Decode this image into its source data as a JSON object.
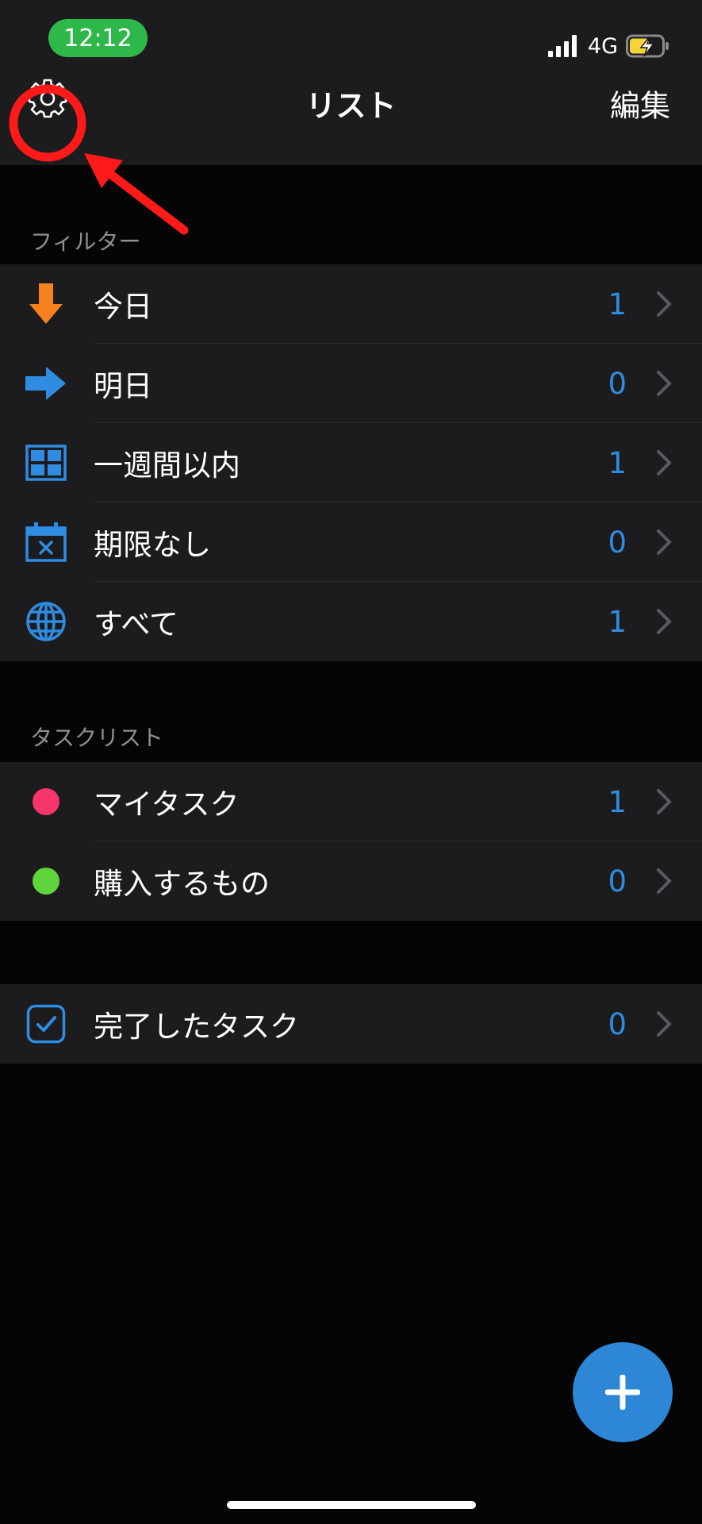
{
  "status_bar": {
    "time": "12:12",
    "network": "4G",
    "pill_color": "#2fb84a"
  },
  "nav": {
    "title": "リスト",
    "edit_label": "編集",
    "settings_icon": "gear-icon"
  },
  "filters": {
    "header": "フィルター",
    "items": [
      {
        "label": "今日",
        "count": "1",
        "icon": "arrow-down-icon",
        "color": "#f5821f"
      },
      {
        "label": "明日",
        "count": "0",
        "icon": "arrow-right-icon",
        "color": "#2f8ce0"
      },
      {
        "label": "一週間以内",
        "count": "1",
        "icon": "calendar-grid-icon",
        "color": "#2f8ce0"
      },
      {
        "label": "期限なし",
        "count": "0",
        "icon": "calendar-x-icon",
        "color": "#2f8ce0"
      },
      {
        "label": "すべて",
        "count": "1",
        "icon": "globe-icon",
        "color": "#2f8ce0"
      }
    ]
  },
  "task_lists": {
    "header": "タスクリスト",
    "items": [
      {
        "label": "マイタスク",
        "count": "1",
        "color": "#f5356b"
      },
      {
        "label": "購入するもの",
        "count": "0",
        "color": "#5fd33c"
      }
    ]
  },
  "completed": {
    "label": "完了したタスク",
    "count": "0",
    "icon": "checkbox-icon"
  },
  "fab": {
    "icon": "plus-icon"
  },
  "colors": {
    "accent": "#2f8ce0",
    "background": "#050505",
    "surface": "#1c1c1e",
    "annotation": "#ff1a1a"
  }
}
